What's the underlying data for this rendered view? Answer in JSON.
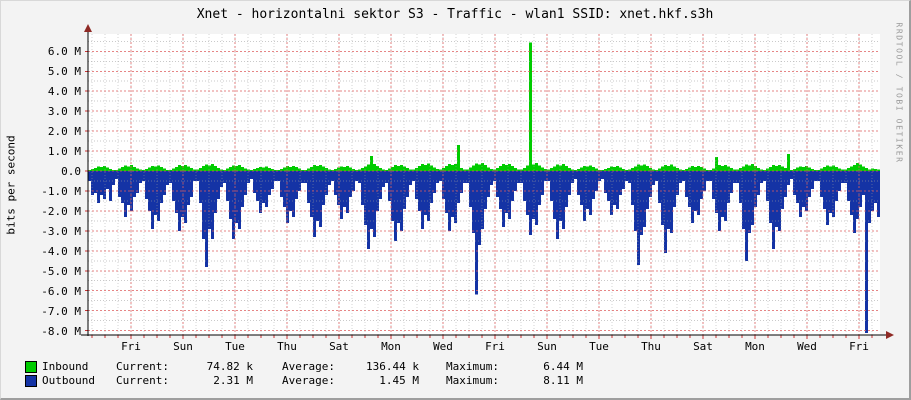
{
  "title": "Xnet - horizontalni sektor S3 - Traffic - wlan1 SSID: xnet.hkf.s3h",
  "watermark": "RRDTOOL / TOBI OETIKER",
  "colors": {
    "background": "#f3f3f3",
    "canvas": "#ffffff",
    "inbound": "#00cc00",
    "outbound": "#1433a5",
    "outbound_line": "#0a1e78",
    "grid_major": "#dd5c5c",
    "grid_minor": "#9e9e9e",
    "tick": "#cc3333",
    "axis": "#000000",
    "arrow": "#8f2a25"
  },
  "legend": {
    "rows": [
      {
        "series": "inbound",
        "label": "Inbound",
        "current_label": "Current:",
        "current": "74.82 k",
        "average_label": "Average:",
        "average": "136.44 k",
        "maximum_label": "Maximum:",
        "maximum": "6.44 M"
      },
      {
        "series": "outbound",
        "label": "Outbound",
        "current_label": "Current:",
        "current": "2.31 M",
        "average_label": "Average:",
        "average": "1.45 M",
        "maximum_label": "Maximum:",
        "maximum": "8.11 M"
      }
    ]
  },
  "chart_data": {
    "type": "area",
    "title": "Xnet - horizontalni sektor S3 - Traffic - wlan1 SSID: xnet.hkf.s3h",
    "xlabel": "",
    "ylabel": "bits per second",
    "unit": "M = megabits per second",
    "ylim": [
      -8.2,
      6.8
    ],
    "grid": true,
    "legend_position": "bottom",
    "y_tick_values": [
      6,
      5,
      4,
      3,
      2,
      1,
      0,
      -1,
      -2,
      -3,
      -4,
      -5,
      -6,
      -7,
      -8
    ],
    "y_tick_labels": [
      "6.0 M",
      "5.0 M",
      "4.0 M",
      "3.0 M",
      "2.0 M",
      "1.0 M",
      "0.0",
      "-1.0 M",
      "-2.0 M",
      "-3.0 M",
      "-4.0 M",
      "-5.0 M",
      "-6.0 M",
      "-7.0 M",
      "-8.0 M"
    ],
    "x_tick_labels": [
      "Fri",
      "Sun",
      "Tue",
      "Thu",
      "Sat",
      "Mon",
      "Wed",
      "Fri",
      "Sun",
      "Tue",
      "Thu",
      "Sat",
      "Mon",
      "Wed",
      "Fri"
    ],
    "series": [
      {
        "name": "Inbound",
        "color": "#00cc00",
        "stats": {
          "current": "74.82 k",
          "average": "136.44 k",
          "maximum": "6.44 M"
        },
        "values": [
          0.05,
          0.1,
          0.16,
          0.22,
          0.19,
          0.24,
          0.17,
          0.11,
          0.06,
          0.06,
          0.12,
          0.2,
          0.27,
          0.23,
          0.29,
          0.21,
          0.13,
          0.07,
          0.05,
          0.11,
          0.18,
          0.25,
          0.22,
          0.27,
          0.19,
          0.12,
          0.06,
          0.06,
          0.13,
          0.21,
          0.29,
          0.25,
          0.31,
          0.22,
          0.14,
          0.07,
          0.07,
          0.14,
          0.24,
          0.33,
          0.28,
          0.35,
          0.25,
          0.15,
          0.08,
          0.06,
          0.12,
          0.2,
          0.28,
          0.24,
          0.3,
          0.21,
          0.13,
          0.07,
          0.04,
          0.09,
          0.15,
          0.21,
          0.18,
          0.22,
          0.16,
          0.1,
          0.05,
          0.05,
          0.11,
          0.18,
          0.25,
          0.21,
          0.26,
          0.19,
          0.12,
          0.06,
          0.06,
          0.13,
          0.21,
          0.29,
          0.25,
          0.31,
          0.22,
          0.14,
          0.07,
          0.05,
          0.1,
          0.17,
          0.23,
          0.2,
          0.25,
          0.18,
          0.11,
          0.06,
          0.07,
          0.14,
          0.23,
          0.32,
          0.75,
          0.34,
          0.24,
          0.15,
          0.08,
          0.06,
          0.13,
          0.21,
          0.29,
          0.25,
          0.31,
          0.22,
          0.14,
          0.07,
          0.08,
          0.16,
          0.26,
          0.36,
          0.31,
          0.38,
          0.27,
          0.17,
          0.09,
          0.07,
          0.15,
          0.25,
          0.34,
          0.29,
          0.36,
          1.3,
          0.16,
          0.08,
          0.08,
          0.17,
          0.28,
          0.38,
          0.33,
          0.4,
          0.29,
          0.18,
          0.1,
          0.07,
          0.15,
          0.24,
          0.34,
          0.29,
          0.36,
          0.26,
          0.16,
          0.08,
          0.08,
          0.16,
          0.27,
          6.44,
          0.32,
          0.39,
          0.28,
          0.17,
          0.09,
          0.07,
          0.14,
          0.23,
          0.32,
          0.28,
          0.34,
          0.24,
          0.15,
          0.08,
          0.05,
          0.11,
          0.18,
          0.25,
          0.22,
          0.27,
          0.19,
          0.12,
          0.06,
          0.05,
          0.1,
          0.16,
          0.23,
          0.2,
          0.24,
          0.17,
          0.11,
          0.06,
          0.07,
          0.14,
          0.23,
          0.32,
          0.27,
          0.33,
          0.24,
          0.15,
          0.08,
          0.06,
          0.13,
          0.22,
          0.3,
          0.26,
          0.32,
          0.23,
          0.14,
          0.07,
          0.05,
          0.11,
          0.18,
          0.25,
          0.21,
          0.26,
          0.19,
          0.12,
          0.06,
          0.06,
          0.13,
          0.7,
          0.3,
          0.25,
          0.31,
          0.22,
          0.14,
          0.07,
          0.07,
          0.14,
          0.23,
          0.32,
          0.28,
          0.34,
          0.24,
          0.15,
          0.08,
          0.06,
          0.13,
          0.21,
          0.3,
          0.26,
          0.31,
          0.22,
          0.14,
          0.85,
          0.05,
          0.1,
          0.17,
          0.23,
          0.2,
          0.25,
          0.18,
          0.11,
          0.06,
          0.06,
          0.12,
          0.19,
          0.27,
          0.23,
          0.28,
          0.2,
          0.13,
          0.07,
          0.07,
          0.14,
          0.22,
          0.31,
          0.4,
          0.33,
          0.23,
          0.15,
          0.08,
          0.12,
          0.09,
          0.07
        ]
      },
      {
        "name": "Outbound",
        "color": "#1433a5",
        "stats": {
          "current": "2.31 M",
          "average": "1.45 M",
          "maximum": "8.11 M"
        },
        "values": [
          -0.5,
          -1.2,
          -1.1,
          -1.6,
          -1.2,
          -1.4,
          -0.9,
          -1.5,
          -0.7,
          -0.4,
          -1.3,
          -1.6,
          -2.3,
          -1.7,
          -2.0,
          -1.3,
          -1.1,
          -0.6,
          -0.5,
          -1.4,
          -2.0,
          -2.9,
          -2.2,
          -2.5,
          -1.6,
          -1.2,
          -0.7,
          -0.6,
          -1.5,
          -2.1,
          -3.0,
          -2.3,
          -2.6,
          -1.7,
          -1.3,
          -0.5,
          -0.5,
          -1.6,
          -3.4,
          -4.8,
          -2.9,
          -3.4,
          -2.1,
          -1.4,
          -0.8,
          -0.6,
          -1.5,
          -2.4,
          -3.4,
          -2.6,
          -2.9,
          -1.8,
          -1.2,
          -0.6,
          -0.4,
          -1.1,
          -1.5,
          -2.1,
          -1.6,
          -1.8,
          -1.2,
          -0.9,
          -0.5,
          -0.5,
          -1.3,
          -1.8,
          -2.6,
          -2.0,
          -2.3,
          -1.4,
          -1.0,
          -0.6,
          -0.6,
          -1.6,
          -2.3,
          -3.3,
          -2.5,
          -2.8,
          -1.7,
          -1.2,
          -0.7,
          -0.5,
          -1.2,
          -1.7,
          -2.4,
          -1.8,
          -2.1,
          -1.3,
          -1.0,
          -0.5,
          -0.6,
          -1.7,
          -2.7,
          -3.9,
          -2.9,
          -3.3,
          -2.0,
          -1.4,
          -0.8,
          -0.6,
          -1.5,
          -2.5,
          -3.5,
          -2.6,
          -3.0,
          -1.9,
          -1.3,
          -0.7,
          -0.5,
          -1.4,
          -2.0,
          -2.9,
          -2.2,
          -2.5,
          -1.6,
          -1.1,
          -0.6,
          -0.5,
          -1.4,
          -2.1,
          -3.0,
          -2.3,
          -2.6,
          -1.6,
          -1.1,
          -0.6,
          -0.6,
          -1.8,
          -3.1,
          -6.2,
          -3.7,
          -2.9,
          -1.9,
          -1.3,
          -0.7,
          -0.5,
          -1.3,
          -1.9,
          -2.8,
          -2.1,
          -2.4,
          -1.5,
          -1.0,
          -0.6,
          -0.6,
          -1.5,
          -2.2,
          -3.2,
          -2.4,
          -2.7,
          -1.7,
          -1.2,
          -0.5,
          -0.5,
          -1.5,
          -2.4,
          -3.4,
          -2.5,
          -2.9,
          -1.8,
          -1.2,
          -0.6,
          -0.4,
          -1.2,
          -1.7,
          -2.5,
          -1.9,
          -2.2,
          -1.4,
          -1.0,
          -0.5,
          -0.4,
          -1.1,
          -1.5,
          -2.2,
          -1.7,
          -1.9,
          -1.2,
          -0.9,
          -0.5,
          -0.6,
          -1.7,
          -3.0,
          -4.7,
          -3.2,
          -2.8,
          -1.9,
          -1.3,
          -0.7,
          -0.5,
          -1.6,
          -2.7,
          -4.1,
          -2.9,
          -3.1,
          -1.8,
          -1.2,
          -0.6,
          -0.5,
          -1.3,
          -1.8,
          -2.6,
          -2.0,
          -2.2,
          -1.4,
          -1.0,
          -0.5,
          -0.5,
          -1.4,
          -2.1,
          -3.0,
          -2.3,
          -2.5,
          -1.6,
          -1.1,
          -0.6,
          -0.6,
          -1.6,
          -2.9,
          -4.5,
          -3.1,
          -2.7,
          -1.8,
          -1.2,
          -0.6,
          -0.5,
          -1.5,
          -2.6,
          -3.9,
          -2.8,
          -3.0,
          -1.9,
          -1.3,
          -0.7,
          -0.4,
          -1.2,
          -1.6,
          -2.3,
          -1.8,
          -2.0,
          -1.3,
          -0.9,
          -0.5,
          -0.5,
          -1.3,
          -1.9,
          -2.7,
          -2.1,
          -2.3,
          -1.5,
          -1.0,
          -0.6,
          -0.6,
          -1.5,
          -2.2,
          -3.1,
          -2.4,
          -1.8,
          -1.2,
          -8.11,
          -2.6,
          -2.0,
          -1.6,
          -2.31
        ]
      }
    ]
  }
}
